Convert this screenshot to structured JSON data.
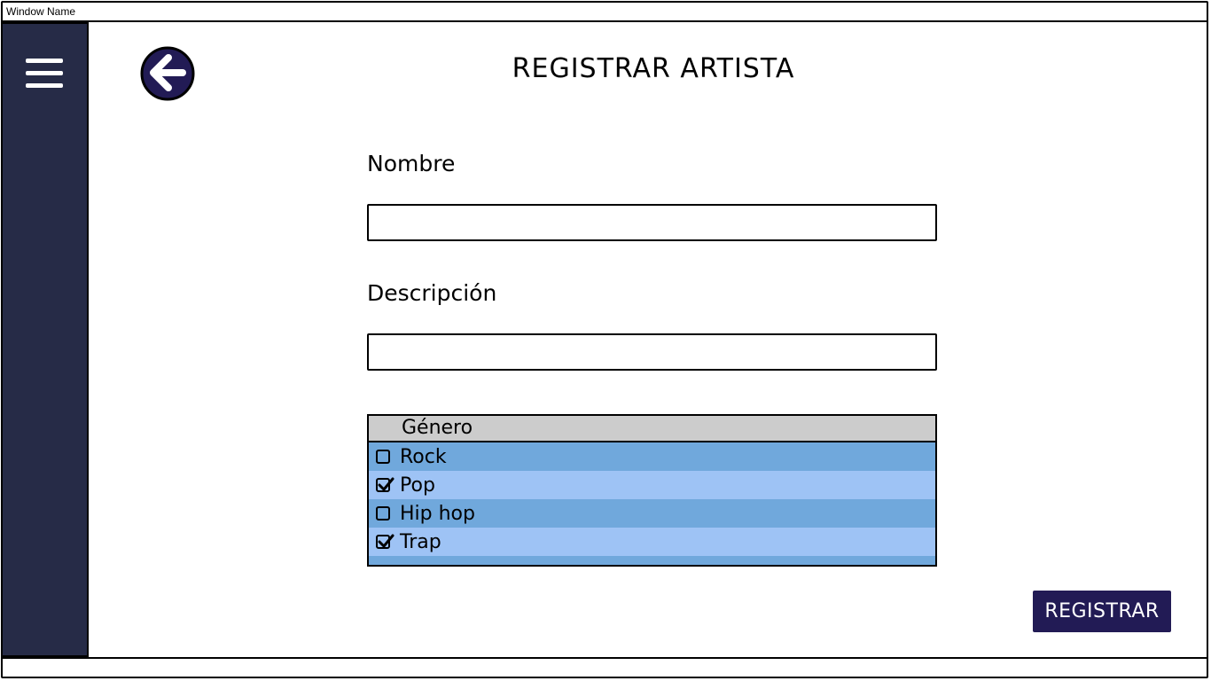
{
  "window": {
    "title": "Window Name"
  },
  "sidebar": {
    "menu_icon": "hamburger-menu-icon",
    "color": "#262b47"
  },
  "header": {
    "back_icon": "arrow-left-circle-icon",
    "title": "REGISTRAR ARTISTA"
  },
  "form": {
    "name_label": "Nombre",
    "name_value": "",
    "description_label": "Descripción",
    "description_value": "",
    "genre": {
      "header": "Género",
      "items": [
        {
          "label": "Rock",
          "checked": false
        },
        {
          "label": "Pop",
          "checked": true
        },
        {
          "label": "Hip hop",
          "checked": false
        },
        {
          "label": "Trap",
          "checked": true
        }
      ]
    },
    "submit_label": "REGISTRAR"
  },
  "colors": {
    "accent": "#221b55",
    "list_row_dark": "#70a8dc",
    "list_row_light": "#9ec3f5",
    "list_header": "#cccccc"
  }
}
